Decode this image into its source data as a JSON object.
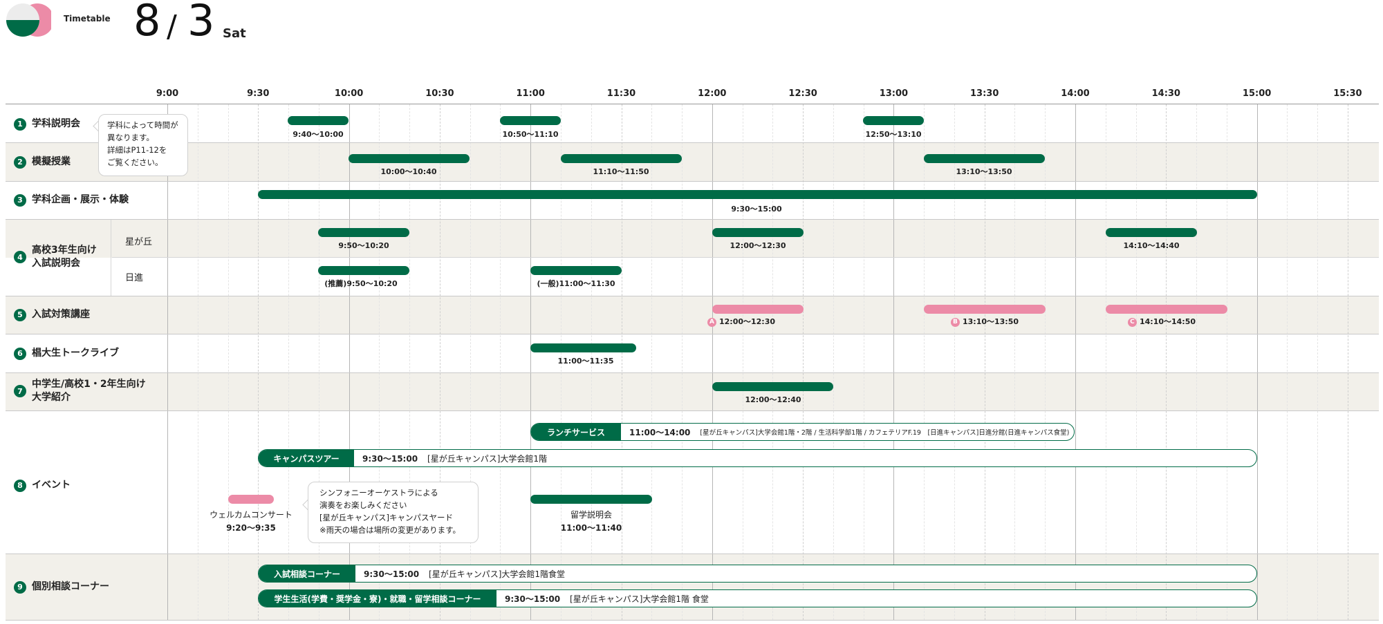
{
  "header": {
    "label": "Timetable",
    "month": "8",
    "slash": "/",
    "day": "3",
    "weekday": "Sat"
  },
  "colors": {
    "green": "#006b47",
    "pink": "#ec8ba7",
    "row_grey": "#f2f0ea"
  },
  "time_axis": [
    "9:00",
    "9:30",
    "10:00",
    "10:30",
    "11:00",
    "11:30",
    "12:00",
    "12:30",
    "13:00",
    "13:30",
    "14:00",
    "14:30",
    "15:00",
    "15:30"
  ],
  "rows": {
    "r1": {
      "num": "1",
      "label": "学科説明会",
      "sessions": [
        {
          "time": "9:40〜10:00"
        },
        {
          "time": "10:50〜11:10"
        },
        {
          "time": "12:50〜13:10"
        }
      ]
    },
    "r2": {
      "num": "2",
      "label": "模擬授業",
      "sessions": [
        {
          "time": "10:00〜10:40"
        },
        {
          "time": "11:10〜11:50"
        },
        {
          "time": "13:10〜13:50"
        }
      ]
    },
    "r3": {
      "num": "3",
      "label": "学科企画・展示・体験",
      "sessions": [
        {
          "time": "9:30〜15:00"
        }
      ]
    },
    "r4": {
      "num": "4",
      "label1": "高校3年生向け",
      "label2": "入試説明会",
      "sub1": {
        "label": "星が丘",
        "sessions": [
          {
            "time": "9:50〜10:20"
          },
          {
            "time": "12:00〜12:30"
          },
          {
            "time": "14:10〜14:40"
          }
        ]
      },
      "sub2": {
        "label": "日進",
        "sessions": [
          {
            "time": "(推薦)9:50〜10:20"
          },
          {
            "time": "(一般)11:00〜11:30"
          }
        ]
      }
    },
    "r5": {
      "num": "5",
      "label": "入試対策講座",
      "sessions": [
        {
          "badge": "A",
          "time": "12:00〜12:30"
        },
        {
          "badge": "B",
          "time": "13:10〜13:50"
        },
        {
          "badge": "C",
          "time": "14:10〜14:50"
        }
      ]
    },
    "r6": {
      "num": "6",
      "label": "椙大生トークライブ",
      "sessions": [
        {
          "time": "11:00〜11:35"
        }
      ]
    },
    "r7": {
      "num": "7",
      "label1": "中学生/高校1・2年生向け",
      "label2": "大学紹介",
      "sessions": [
        {
          "time": "12:00〜12:40"
        }
      ]
    },
    "r8": {
      "num": "8",
      "label": "イベント",
      "lunch": {
        "title": "ランチサービス",
        "time": "11:00〜14:00",
        "place": "[星が丘キャンパス]大学会館1階・2階 / 生活科学部1階 / カフェテリアF.19　[日進キャンパス]日進分館(日進キャンパス食堂)"
      },
      "tour": {
        "title": "キャンパスツアー",
        "time": "9:30〜15:00",
        "place": "[星が丘キャンパス]大学会館1階"
      },
      "concert": {
        "name": "ウェルカムコンサート",
        "time": "9:20〜9:35"
      },
      "concert_note": [
        "シンフォニーオーケストラによる",
        "演奏をお楽しみください",
        "[星が丘キャンパス]キャンパスヤード",
        "※雨天の場合は場所の変更があります。"
      ],
      "study_abroad": {
        "name": "留学説明会",
        "time": "11:00〜11:40"
      }
    },
    "r9": {
      "num": "9",
      "label": "個別相談コーナー",
      "admission": {
        "title": "入試相談コーナー",
        "time": "9:30〜15:00",
        "place": "[星が丘キャンパス]大学会館1階食堂"
      },
      "student": {
        "title": "学生生活(学費・奨学金・寮)・就職・留学相談コーナー",
        "time": "9:30〜15:00",
        "place": "[星が丘キャンパス]大学会館1階 食堂"
      }
    }
  },
  "note1": [
    "学科によって時間が",
    "異なります。",
    "詳細はP11-12を",
    "ご覧ください。"
  ]
}
